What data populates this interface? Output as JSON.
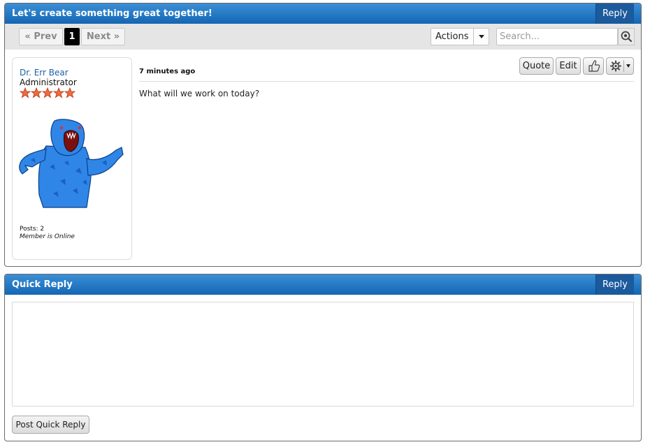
{
  "topic": {
    "title": "Let's create something great together!",
    "reply_label": "Reply"
  },
  "toolbar": {
    "prev_label": "« Prev",
    "current_page": "1",
    "next_label": "Next »",
    "actions_label": "Actions",
    "search_placeholder": "Search..."
  },
  "post": {
    "author": "Dr. Err Bear",
    "role": "Administrator",
    "star_count": 5,
    "posts": "Posts: 2",
    "status": "Member is Online",
    "time": "7 minutes ago",
    "body": "What will we work on today?",
    "quote_label": "Quote",
    "edit_label": "Edit"
  },
  "quick_reply": {
    "title": "Quick Reply",
    "reply_label": "Reply",
    "submit_label": "Post Quick Reply"
  },
  "colors": {
    "header_blue": "#1466b3",
    "reply_button": "#1b5a9c",
    "username_link": "#1a5fa8",
    "star": "#f26a3f",
    "avatar_blue": "#2f86e6"
  }
}
